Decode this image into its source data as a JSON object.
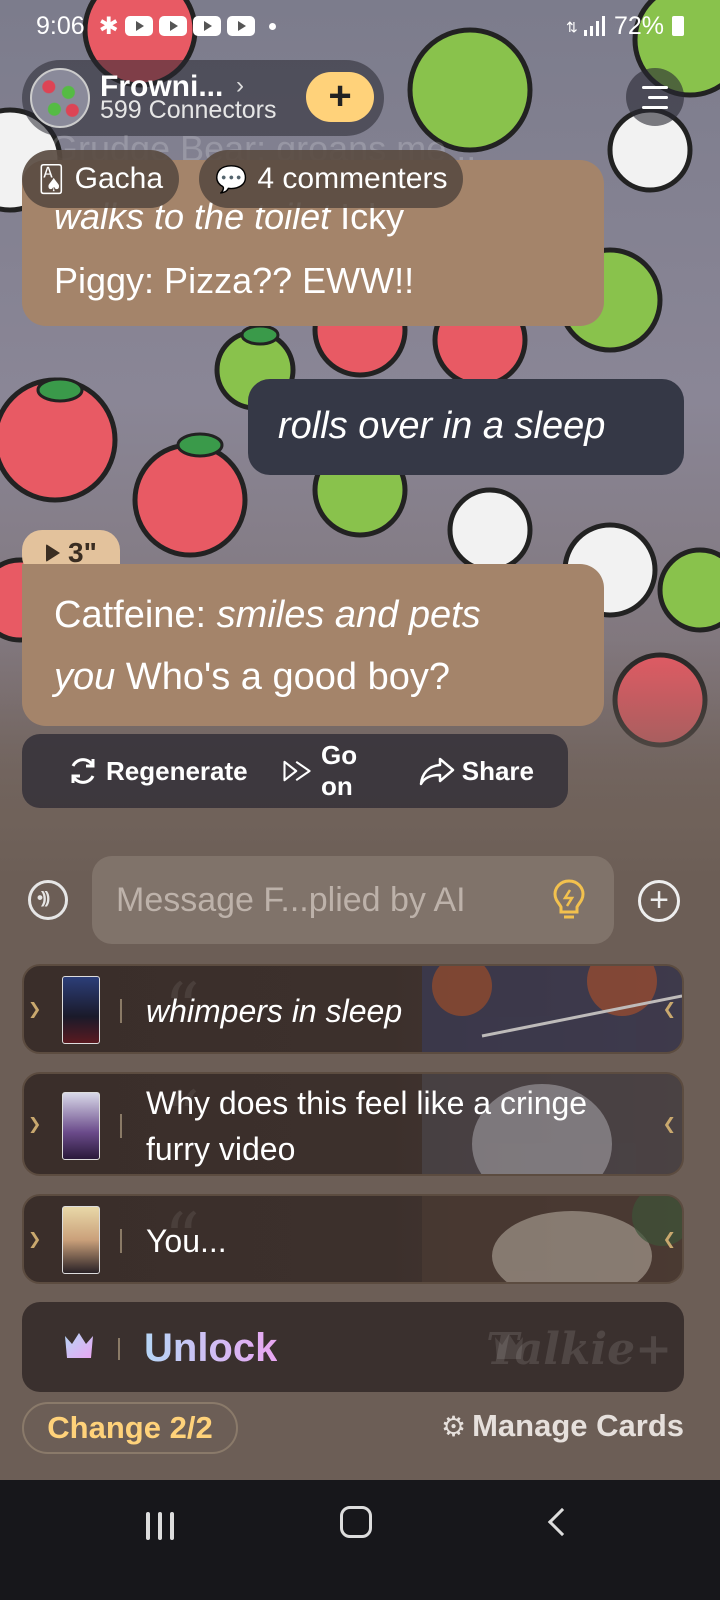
{
  "status_bar": {
    "time": "9:06",
    "battery": "72%",
    "notification_icons": [
      "gear-icon",
      "youtube-icon",
      "youtube-icon",
      "youtube-icon",
      "youtube-icon",
      "dot-icon"
    ]
  },
  "header": {
    "bot_name": "Frowni...",
    "connectors": "599 Connectors",
    "add_label": "+",
    "chevron": "›"
  },
  "ghost_text": "Grudge Bear: groans me...",
  "chips": {
    "gacha": "Gacha",
    "commenters": "4 commenters"
  },
  "messages": [
    {
      "role": "bot",
      "line1_italic": "walks to the toilet",
      "line1_rest": " Icky",
      "line2": "Piggy: Pizza?? EWW!!"
    },
    {
      "role": "user",
      "text": "rolls over in a sleep"
    },
    {
      "role": "bot",
      "audio_duration": "3\"",
      "speaker": "Catfeine: ",
      "italic_a": "smiles and pets",
      "italic_b": "you",
      "rest": " Who's a good boy?"
    }
  ],
  "actions": {
    "regenerate": "Regenerate",
    "go_on": "Go on",
    "share": "Share"
  },
  "composer": {
    "placeholder": "Message F...plied by AI"
  },
  "suggestions": [
    {
      "text": "whimpers in sleep",
      "italic": true
    },
    {
      "text": "Why does this feel like a cringe furry video",
      "italic": false
    },
    {
      "text": "You...",
      "italic": false
    }
  ],
  "unlock": {
    "label": "Unlock",
    "brand": "Talkie+"
  },
  "footer": {
    "change": "Change 2/2",
    "manage": "Manage Cards"
  },
  "colors": {
    "bot_bubble": "#a4846a",
    "user_bubble": "#353846",
    "accent_yellow": "#ffd27a",
    "nav_bar": "#17171b"
  }
}
